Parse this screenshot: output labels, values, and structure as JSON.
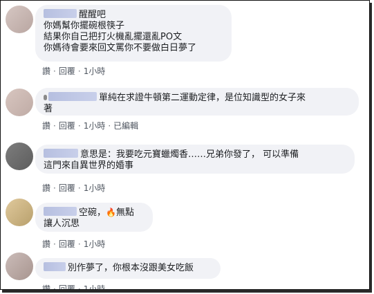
{
  "actions": {
    "like": "讚",
    "reply": "回覆",
    "separator": "·",
    "edited": "已編輯"
  },
  "comments": [
    {
      "lines": [
        "醒醒吧",
        "你媽幫你擺碗根筷子",
        "結果你自己把打火機亂擺還亂PO文",
        "你媽待會要來回文罵你不要做白日夢了"
      ],
      "time": "1小時",
      "avatar_color": "#c9b8b4"
    },
    {
      "lines": [
        "單純在求證牛頓第二運動定律，是位知識型的女子來",
        "著"
      ],
      "time": "1小時",
      "edited": true,
      "avatar_color": "#c8b8b3"
    },
    {
      "lines": [
        "意思是：我要吃元寶蠟燭香……兄弟你發了， 可以準備",
        "這門來自異世界的婚事"
      ],
      "time": "1小時",
      "avatar_color": "#6b6b6b"
    },
    {
      "lines": [
        "空碗，",
        "無點",
        "讓人沉思"
      ],
      "time": "1小時",
      "avatar_color": "#d2b98a"
    },
    {
      "lines": [
        "別作夢了，你根本沒跟美女吃飯"
      ],
      "time": "1小時",
      "avatar_color": "#b9a9a6"
    }
  ]
}
